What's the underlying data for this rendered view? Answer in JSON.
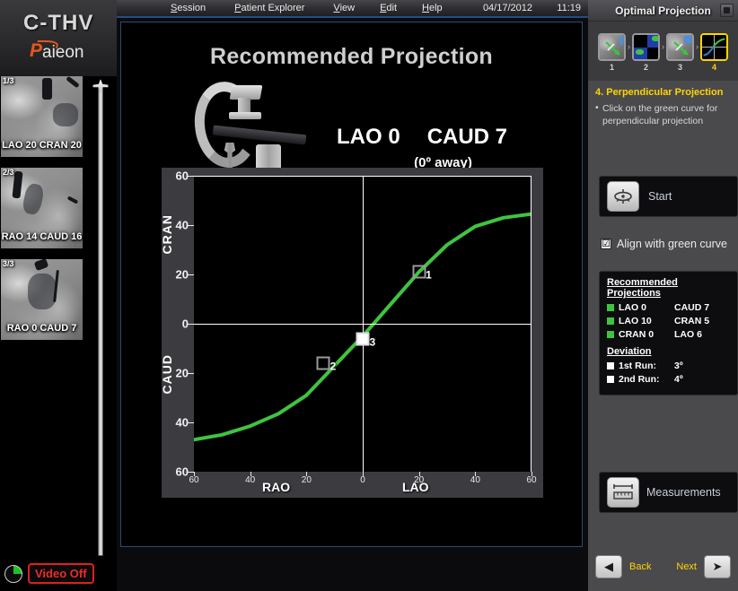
{
  "brand": {
    "product": "C-THV",
    "company_p": "P",
    "company_rest": "aieon"
  },
  "menubar": {
    "items": [
      {
        "accel": "S",
        "rest": "ession"
      },
      {
        "accel": "P",
        "rest": "atient Explorer"
      },
      {
        "accel": "V",
        "rest": "iew"
      },
      {
        "accel": "E",
        "rest": "dit"
      },
      {
        "accel": "H",
        "rest": "elp"
      }
    ],
    "date": "04/17/2012",
    "time": "11:19"
  },
  "thumbnails": [
    {
      "index": "1/3",
      "label": "LAO 20 CRAN 20"
    },
    {
      "index": "2/3",
      "label": "RAO 14 CAUD 16"
    },
    {
      "index": "3/3",
      "label": "RAO 0 CAUD 7"
    }
  ],
  "video": {
    "status_label": "Video Off",
    "indicator_icon": "pie-indicator-icon",
    "status_color": "#ef2b2b"
  },
  "viewport": {
    "title": "Recommended Projection",
    "carm_icon": "c-arm-gantry-icon",
    "projection_primary": "LAO  0",
    "projection_secondary": "CAUD  7",
    "away_text": "(0º away)"
  },
  "chart_data": {
    "type": "line",
    "title": "Recommended Projection",
    "xlabel_left": "RAO",
    "xlabel_right": "LAO",
    "ylabel_top": "CRAN",
    "ylabel_bottom": "CAUD",
    "xlim": [
      -60,
      60
    ],
    "ylim": [
      -60,
      60
    ],
    "xticks": [
      -60,
      -40,
      -20,
      0,
      20,
      40,
      60
    ],
    "xtick_labels": [
      "60",
      "40",
      "20",
      "0",
      "20",
      "40",
      "60"
    ],
    "yticks": [
      60,
      40,
      20,
      0,
      -20,
      -40,
      -60
    ],
    "ytick_labels": [
      "60",
      "40",
      "20",
      "0",
      "20",
      "40",
      "60"
    ],
    "grid": false,
    "axis_lines": {
      "x_zero": true,
      "y_zero": true,
      "top_border": true,
      "right_border": true
    },
    "series": [
      {
        "name": "perpendicular projection curve",
        "color": "#3fc43f",
        "x": [
          -60,
          -50,
          -40,
          -30,
          -20,
          -10,
          -5,
          0,
          5,
          10,
          20,
          30,
          40,
          50,
          60
        ],
        "y": [
          -47,
          -45,
          -41.5,
          -36.5,
          -29,
          -17,
          -11,
          -5,
          1.5,
          8,
          21,
          32,
          39.5,
          43,
          44.5
        ]
      }
    ],
    "markers": [
      {
        "label": "1",
        "x": 20,
        "y": 21,
        "selected": false,
        "color": "#9a9a9a"
      },
      {
        "label": "2",
        "x": -14,
        "y": -16,
        "selected": false,
        "color": "#9a9a9a"
      },
      {
        "label": "3",
        "x": 0,
        "y": -6,
        "selected": true,
        "color": "#ffffff"
      }
    ]
  },
  "right_panel": {
    "title": "Optimal Projection",
    "collapse_icon": "collapse-panel-icon",
    "steps": [
      {
        "num": "1",
        "icon": "angio-arrow-thumb-icon",
        "active": false
      },
      {
        "num": "2",
        "icon": "quad-view-thumb-icon",
        "active": false
      },
      {
        "num": "3",
        "icon": "angio-arrow-thumb-icon",
        "active": false
      },
      {
        "num": "4",
        "icon": "curve-chart-thumb-icon",
        "active": true
      }
    ],
    "step_separator": "›",
    "instruction_title": "4. Perpendicular Projection",
    "instruction_bullet": "Click on the green curve for perpendicular projection",
    "start_button": {
      "label": "Start",
      "icon": "fluoro-start-icon"
    },
    "align_checkbox": {
      "label": "Align with green curve",
      "checked": true,
      "glyph": "☑"
    },
    "recommended": {
      "heading": "Recommended Projections",
      "rows": [
        {
          "swatch": "#3fc43f",
          "a": "LAO 0",
          "b": "CAUD 7"
        },
        {
          "swatch": "#3fc43f",
          "a": "LAO 10",
          "b": "CRAN 5"
        },
        {
          "swatch": "#3fc43f",
          "a": "CRAN 0",
          "b": "LAO 6"
        }
      ],
      "deviation_heading": "Deviation",
      "deviation_rows": [
        {
          "swatch": "#ffffff",
          "a": "1st Run:",
          "b": "3º"
        },
        {
          "swatch": "#ffffff",
          "a": "2nd Run:",
          "b": "4º"
        }
      ]
    },
    "measurements_button": {
      "label": "Measurements",
      "icon": "ruler-icon"
    },
    "nav": {
      "back_label": "Back",
      "next_label": "Next",
      "back_icon": "arrow-left-icon",
      "next_icon": "arrow-right-icon"
    }
  }
}
